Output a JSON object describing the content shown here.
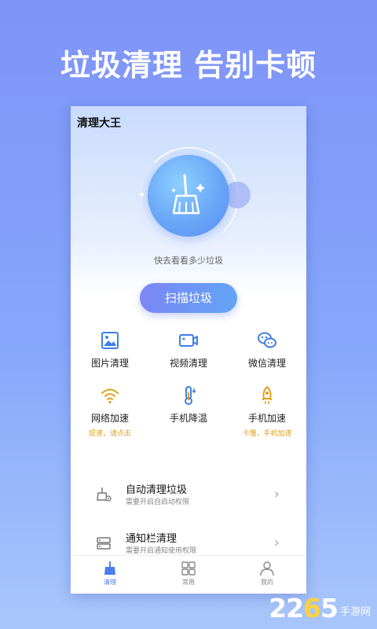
{
  "headline": "垃圾清理 告别卡顿",
  "app": {
    "title": "清理大王",
    "hint": "快去看看多少垃圾",
    "scan_button": "扫描垃圾"
  },
  "tools": [
    {
      "label": "图片清理",
      "sub": "",
      "icon": "image-icon"
    },
    {
      "label": "视频清理",
      "sub": "",
      "icon": "video-icon"
    },
    {
      "label": "微信清理",
      "sub": "",
      "icon": "wechat-icon"
    },
    {
      "label": "网络加速",
      "sub": "提速，请点击",
      "icon": "wifi-icon"
    },
    {
      "label": "手机降温",
      "sub": "",
      "icon": "thermometer-icon"
    },
    {
      "label": "手机加速",
      "sub": "卡慢，手机加速",
      "icon": "rocket-icon"
    }
  ],
  "rows": [
    {
      "title": "自动清理垃圾",
      "sub": "需要开启自启动权限",
      "icon": "broom-gear-icon"
    },
    {
      "title": "通知栏清理",
      "sub": "需要开启通知使用权限",
      "icon": "notification-list-icon"
    }
  ],
  "tabs": [
    {
      "label": "清理",
      "icon": "broom-icon",
      "active": true
    },
    {
      "label": "常用",
      "icon": "grid-icon",
      "active": false
    },
    {
      "label": "我的",
      "icon": "user-icon",
      "active": false
    }
  ],
  "watermark": {
    "num_a": "22",
    "num_b": "6",
    "num_c": "5",
    "site": "手游网"
  },
  "colors": {
    "accent": "#4b7df2",
    "icon_blue": "#3f7ee8",
    "icon_orange": "#e0a11b",
    "background": "#8198f8"
  }
}
